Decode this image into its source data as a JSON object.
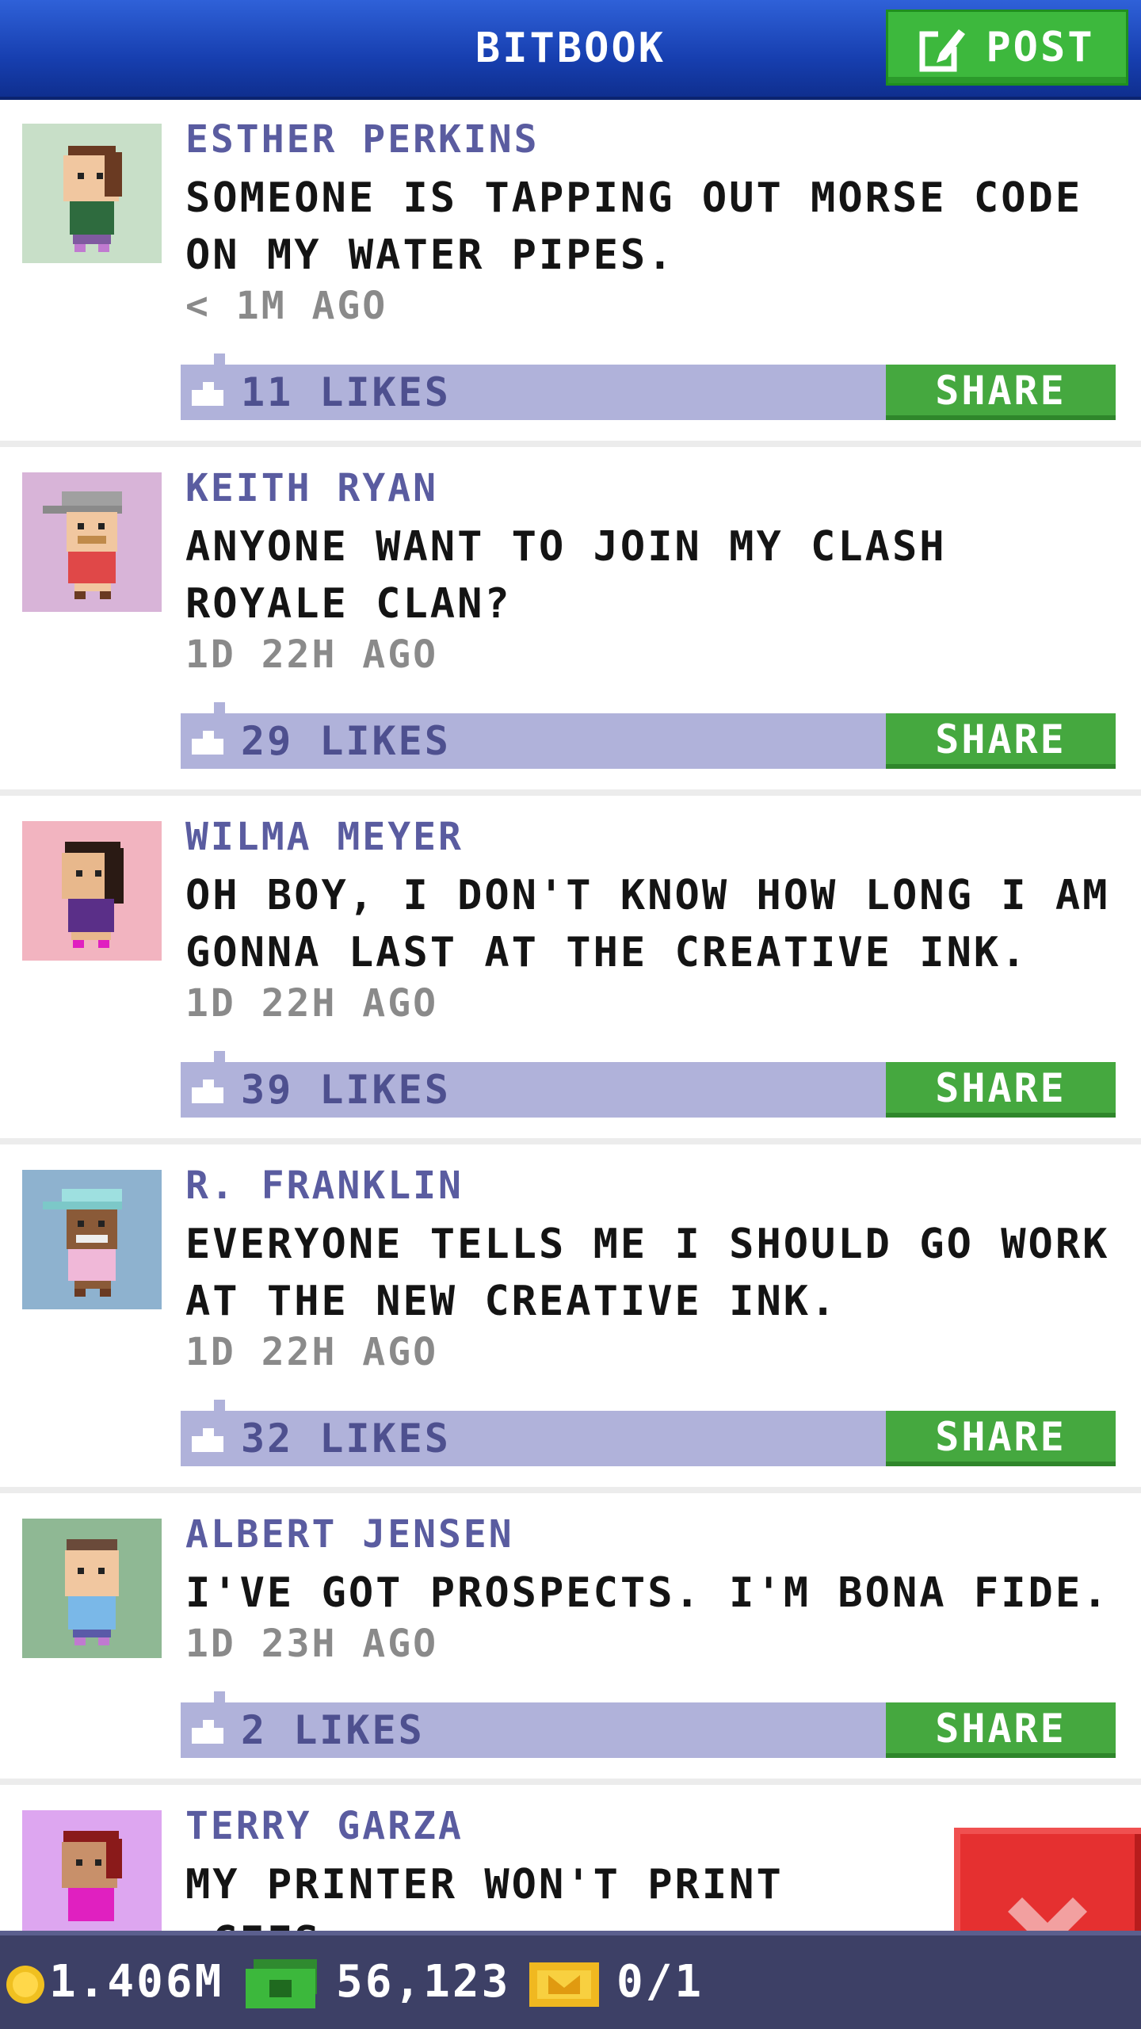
{
  "header": {
    "title": "BITBOOK",
    "post_label": "POST"
  },
  "posts": [
    {
      "author": "ESTHER PERKINS",
      "message": "SOMEONE IS TAPPING OUT MORSE CODE ON MY WATER PIPES.",
      "time": "< 1M AGO",
      "likes": "11 LIKES",
      "share": "SHARE",
      "avatar_bg": "#c8dfc8"
    },
    {
      "author": "KEITH RYAN",
      "message": "ANYONE WANT TO JOIN MY CLASH ROYALE CLAN?",
      "time": "1D 22H AGO",
      "likes": "29 LIKES",
      "share": "SHARE",
      "avatar_bg": "#d8b4d8"
    },
    {
      "author": "WILMA MEYER",
      "message": "OH BOY, I DON'T KNOW HOW LONG I AM GONNA LAST AT THE CREATIVE INK.",
      "time": "1D 22H AGO",
      "likes": "39 LIKES",
      "share": "SHARE",
      "avatar_bg": "#f2b4c0"
    },
    {
      "author": "R. FRANKLIN",
      "message": "EVERYONE TELLS ME I SHOULD GO WORK AT THE NEW CREATIVE INK.",
      "time": "1D 22H AGO",
      "likes": "32 LIKES",
      "share": "SHARE",
      "avatar_bg": "#8eb2cf"
    },
    {
      "author": "ALBERT JENSEN",
      "message": "I'VE GOT PROSPECTS. I'M BONA FIDE.",
      "time": "1D 23H AGO",
      "likes": "2 LIKES",
      "share": "SHARE",
      "avatar_bg": "#8fb894"
    },
    {
      "author": "TERRY GARZA",
      "message": "MY PRINTER WON'T PRINT .GIFS",
      "avatar_bg": "#dda6f0"
    }
  ],
  "status": {
    "coins": "1.406M",
    "cash": "56,123",
    "tickets": "0/1"
  },
  "colors": {
    "header_blue": "#1d47c0",
    "post_green": "#3db83d",
    "like_bar": "#b0b2da",
    "share_green": "#45a83f",
    "close_red": "#e53030"
  }
}
